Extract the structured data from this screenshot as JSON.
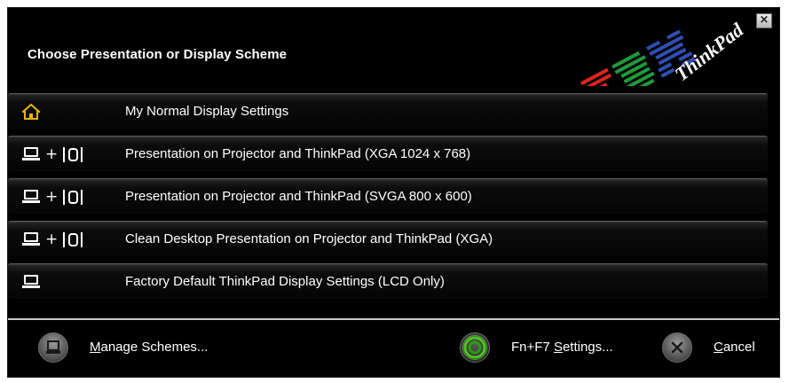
{
  "window": {
    "title": "Choose Presentation or Display Scheme",
    "close_glyph": "×",
    "logo": {
      "brand": "IBM",
      "product": "ThinkPad"
    }
  },
  "schemes": [
    {
      "icon": "home-icon",
      "label": "My Normal Display Settings"
    },
    {
      "icon": "laptop-plus-projector-icon",
      "label": "Presentation on Projector and ThinkPad (XGA 1024 x 768)"
    },
    {
      "icon": "laptop-plus-projector-icon",
      "label": "Presentation on Projector and ThinkPad (SVGA 800 x 600)"
    },
    {
      "icon": "laptop-plus-projector-icon",
      "label": "Clean Desktop Presentation on Projector and ThinkPad (XGA)"
    },
    {
      "icon": "laptop-icon",
      "label": "Factory Default ThinkPad Display Settings (LCD Only)"
    }
  ],
  "icons": {
    "plus": "+"
  },
  "buttons": {
    "manage": {
      "mnemonic": "M",
      "rest": "anage Schemes..."
    },
    "settings": {
      "prefix": "Fn+F7 ",
      "mnemonic": "S",
      "rest": "ettings..."
    },
    "cancel": {
      "mnemonic": "C",
      "rest": "ancel",
      "glyph": "×"
    }
  },
  "colors": {
    "background": "#000000",
    "text": "#ffffff",
    "home_icon": "#e8b400",
    "settings_ring": "#46c81e",
    "separator": "#c8c8c8"
  }
}
